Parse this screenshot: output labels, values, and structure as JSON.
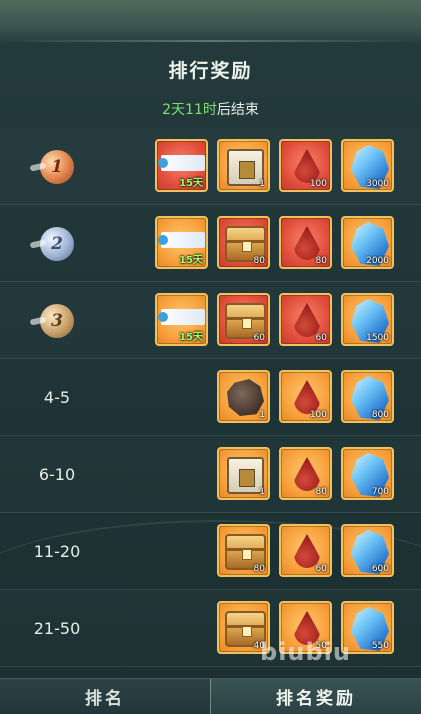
{
  "header": {
    "title": "排行奖励",
    "countdown_time": "2天11时",
    "countdown_suffix": "后结束"
  },
  "rows": [
    {
      "rank": "1",
      "rank_style": "gold",
      "items": [
        {
          "icon": "title-scroll-icon",
          "bg": "red",
          "count": "15天",
          "count_style": "green"
        },
        {
          "icon": "stone-chest-icon",
          "bg": "orange",
          "count": "1"
        },
        {
          "icon": "blood-drop-icon",
          "bg": "red",
          "count": "100"
        },
        {
          "icon": "blue-crystal-icon",
          "bg": "orange",
          "count": "3000"
        }
      ]
    },
    {
      "rank": "2",
      "rank_style": "silver",
      "items": [
        {
          "icon": "title-scroll-icon",
          "bg": "orange",
          "count": "15天",
          "count_style": "green"
        },
        {
          "icon": "golden-chest-icon",
          "bg": "red",
          "count": "80"
        },
        {
          "icon": "blood-drop-icon",
          "bg": "red",
          "count": "80"
        },
        {
          "icon": "blue-crystal-icon",
          "bg": "orange",
          "count": "2000"
        }
      ]
    },
    {
      "rank": "3",
      "rank_style": "bronze",
      "items": [
        {
          "icon": "title-scroll-icon",
          "bg": "orange",
          "count": "15天",
          "count_style": "green"
        },
        {
          "icon": "golden-chest-icon",
          "bg": "red",
          "count": "60"
        },
        {
          "icon": "blood-drop-icon",
          "bg": "red",
          "count": "60"
        },
        {
          "icon": "blue-crystal-icon",
          "bg": "orange",
          "count": "1500"
        }
      ]
    },
    {
      "rank": "4-5",
      "items": [
        {
          "icon": "ore-icon",
          "bg": "orange",
          "count": "1"
        },
        {
          "icon": "blood-drop-icon",
          "bg": "orange",
          "count": "100"
        },
        {
          "icon": "blue-crystal-icon",
          "bg": "orange",
          "count": "800"
        }
      ]
    },
    {
      "rank": "6-10",
      "items": [
        {
          "icon": "stone-chest-icon",
          "bg": "orange",
          "count": "1"
        },
        {
          "icon": "blood-drop-icon",
          "bg": "orange",
          "count": "80"
        },
        {
          "icon": "blue-crystal-icon",
          "bg": "orange",
          "count": "700"
        }
      ]
    },
    {
      "rank": "11-20",
      "items": [
        {
          "icon": "golden-chest-icon",
          "bg": "orange",
          "count": "80"
        },
        {
          "icon": "blood-drop-icon",
          "bg": "orange",
          "count": "60"
        },
        {
          "icon": "blue-crystal-icon",
          "bg": "orange",
          "count": "600"
        }
      ]
    },
    {
      "rank": "21-50",
      "items": [
        {
          "icon": "golden-chest-icon",
          "bg": "orange",
          "count": "40"
        },
        {
          "icon": "blood-drop-icon",
          "bg": "orange",
          "count": "50"
        },
        {
          "icon": "blue-crystal-icon",
          "bg": "orange",
          "count": "550"
        }
      ]
    }
  ],
  "tabs": [
    {
      "label": "排名",
      "active": false
    },
    {
      "label": "排名奖励",
      "active": true
    }
  ],
  "watermark": "biubiu",
  "colors": {
    "countdown_green": "#7fe06b",
    "item_border": "#f0c35a"
  }
}
